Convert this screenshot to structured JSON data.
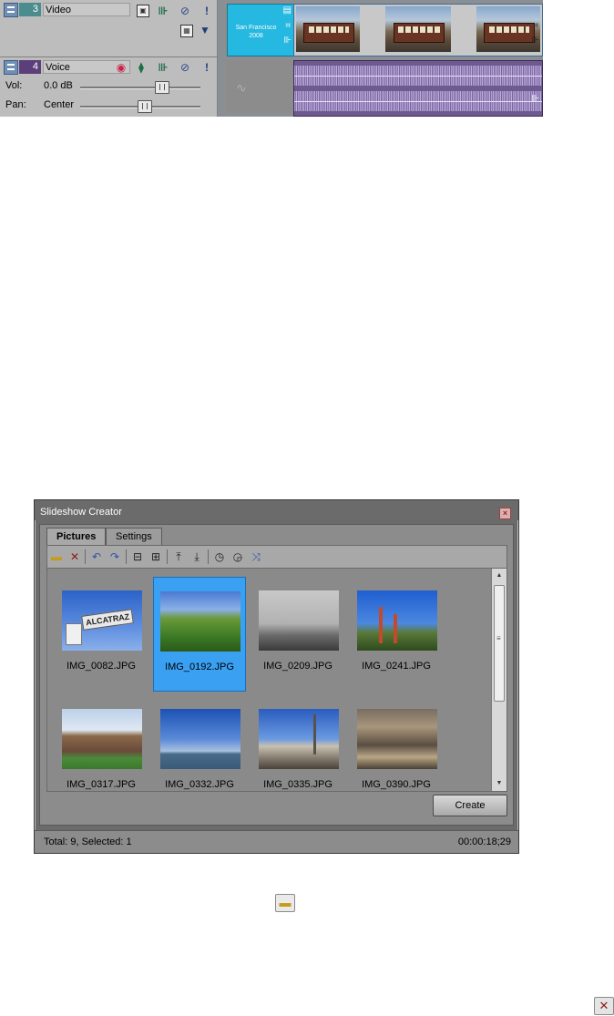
{
  "timeline": {
    "tracks": [
      {
        "number": "3",
        "name": "Video"
      },
      {
        "number": "4",
        "name": "Voice",
        "vol_label": "Vol:",
        "vol_value": "0.0 dB",
        "pan_label": "Pan:",
        "pan_value": "Center"
      }
    ],
    "title_clip": {
      "line1": "San Francisco",
      "line2": "2008"
    },
    "colors": {
      "video_track": "#4b8c8c",
      "voice_track": "#5c3e7a",
      "title_clip": "#25b8e0",
      "audio_clip": "#6e5a8e"
    }
  },
  "slideshow": {
    "title": "Slideshow Creator",
    "close_icon": "close-icon",
    "tabs": [
      {
        "label": "Pictures"
      },
      {
        "label": "Settings"
      }
    ],
    "toolbar_icons": [
      "open-folder-icon",
      "delete-icon",
      "rotate-left-icon",
      "rotate-right-icon",
      "move-left-icon",
      "move-right-icon",
      "move-first-icon",
      "move-last-icon",
      "sort-time-asc-icon",
      "sort-time-desc-icon",
      "shuffle-icon"
    ],
    "images": [
      {
        "filename": "IMG_0082.JPG",
        "selected": false
      },
      {
        "filename": "IMG_0192.JPG",
        "selected": true
      },
      {
        "filename": "IMG_0209.JPG",
        "selected": false
      },
      {
        "filename": "IMG_0241.JPG",
        "selected": false
      },
      {
        "filename": "IMG_0317.JPG",
        "selected": false
      },
      {
        "filename": "IMG_0332.JPG",
        "selected": false
      },
      {
        "filename": "IMG_0335.JPG",
        "selected": false
      },
      {
        "filename": "IMG_0390.JPG",
        "selected": false
      }
    ],
    "create_label": "Create",
    "status_left": "Total: 9, Selected: 1",
    "status_right": "00:00:18;29",
    "colors": {
      "selection": "#3aa0f2",
      "window": "#6b6b6b"
    }
  },
  "icons": {
    "open_folder": "open-folder-icon",
    "delete": "delete-icon"
  }
}
